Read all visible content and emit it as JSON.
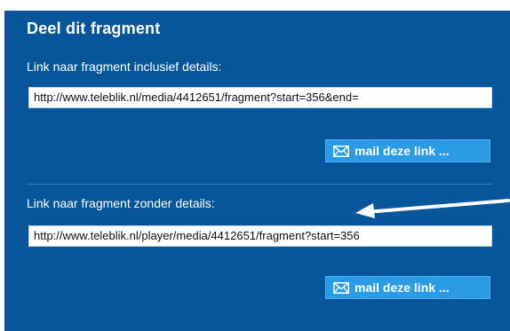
{
  "share": {
    "title": "Deel dit fragment",
    "link_with_details_label": "Link naar fragment inclusief details:",
    "link_with_details_value": "http://www.teleblik.nl/media/4412651/fragment?start=356&end=",
    "link_without_details_label": "Link naar fragment zonder details:",
    "link_without_details_value": "http://www.teleblik.nl/player/media/4412651/fragment?start=356",
    "mail_button_label": "mail deze link ..."
  },
  "colors": {
    "panel_background": "#07569a",
    "button_background": "#2c9be5",
    "arrow": "#ffffff"
  },
  "icons": {
    "mail": "envelope-icon",
    "pointer": "arrow-left-icon"
  }
}
